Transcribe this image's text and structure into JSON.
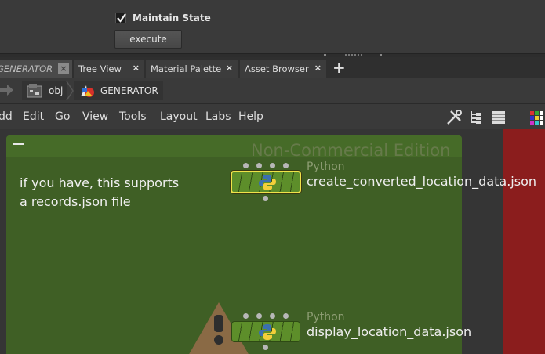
{
  "params": {
    "maintain_state_label": "Maintain State",
    "maintain_state_checked": true,
    "execute_label": "execute"
  },
  "tabs": [
    {
      "label": "GENERATOR",
      "active": true
    },
    {
      "label": "Tree View"
    },
    {
      "label": "Material Palette"
    },
    {
      "label": "Asset Browser"
    }
  ],
  "tab_close_glyph": "×",
  "new_tab_glyph": "+",
  "path": {
    "crumbs": [
      {
        "label": "obj",
        "icon": "object-network-icon"
      },
      {
        "label": "GENERATOR",
        "icon": "geometry-node-icon"
      }
    ]
  },
  "menu": [
    "dd",
    "Edit",
    "Go",
    "View",
    "Tools",
    "Layout",
    "Labs",
    "Help"
  ],
  "network": {
    "watermark": "Non-Commercial Edition",
    "note_line1": "if you have, this supports",
    "note_line2": "a records.json file",
    "nodes": [
      {
        "type": "Python",
        "name": "create_converted_location_data.json",
        "selected": true
      },
      {
        "type": "Python",
        "name": "display_location_data.json",
        "selected": false
      }
    ]
  },
  "colors": {
    "network_box": "#3f5f25",
    "node_fill": "#5d8e2a",
    "selection": "#f0e24a",
    "side_strip": "#8b1d1d"
  }
}
